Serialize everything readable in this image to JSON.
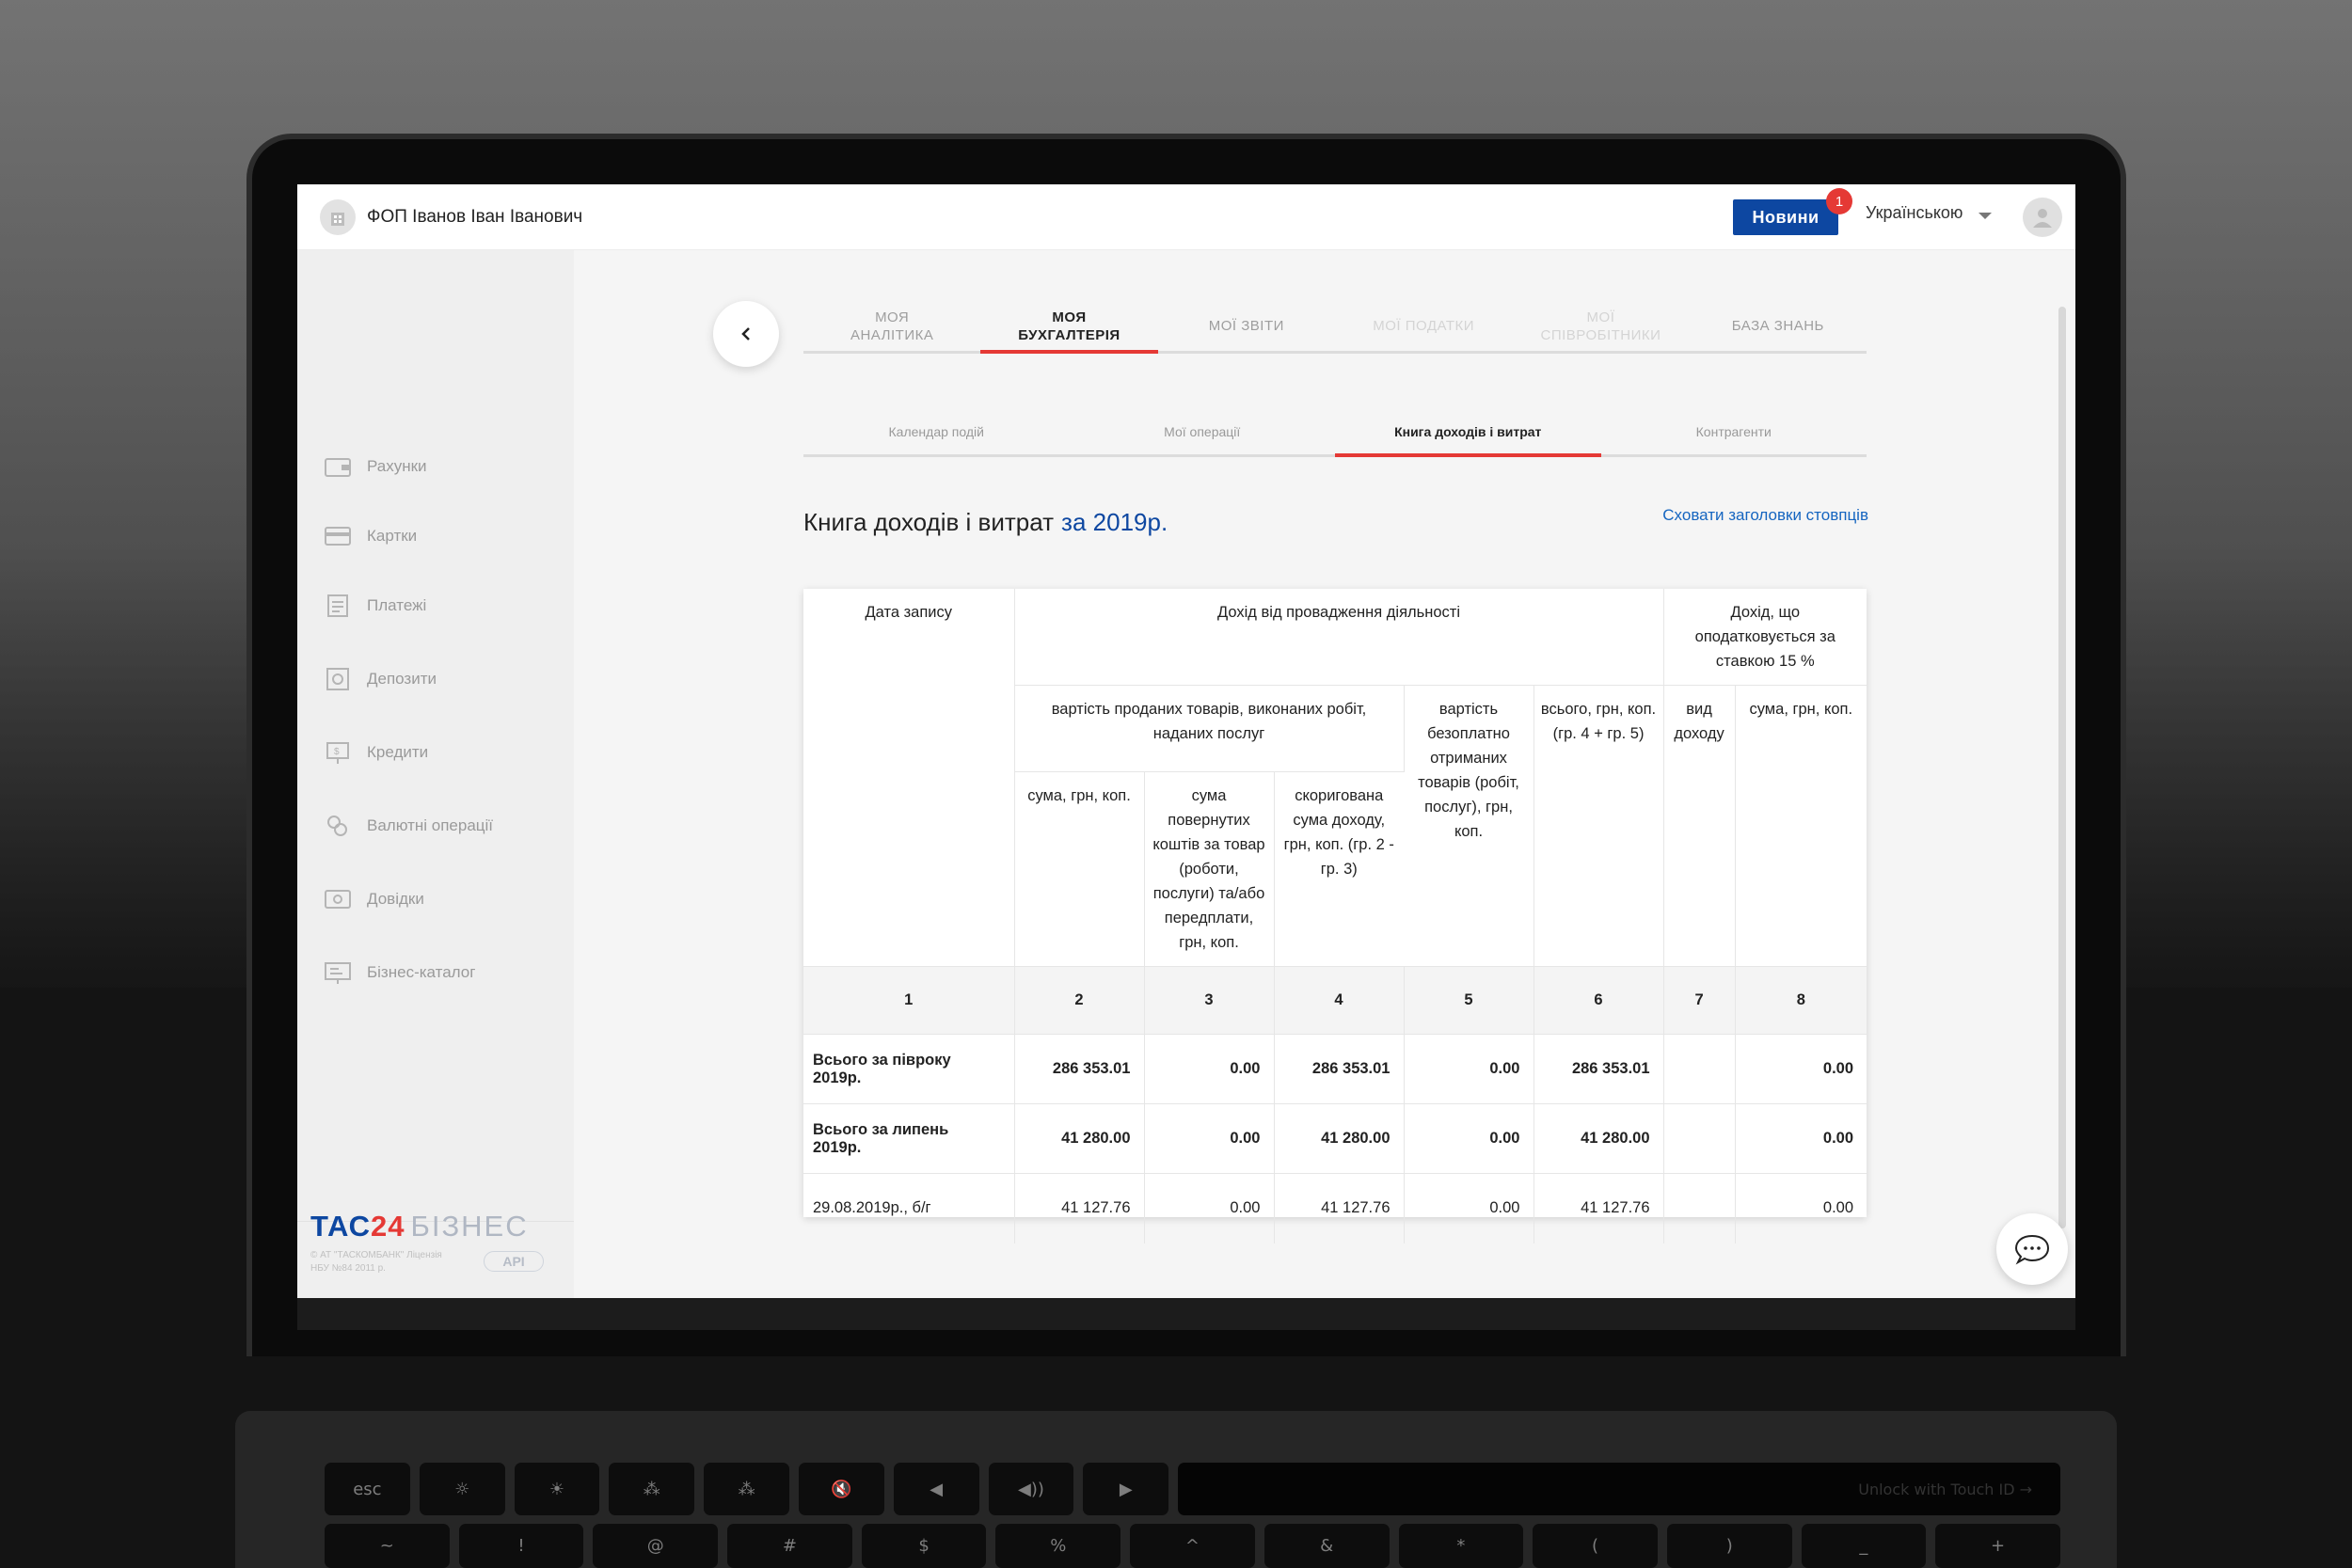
{
  "header": {
    "company_name": "ФОП Іванов Іван Іванович",
    "news_label": "Новини",
    "news_count": "1",
    "language": "Українською"
  },
  "sidebar": {
    "items": [
      {
        "label": "Рахунки",
        "icon": "wallet-icon"
      },
      {
        "label": "Картки",
        "icon": "card-icon"
      },
      {
        "label": "Платежі",
        "icon": "payments-icon"
      },
      {
        "label": "Депозити",
        "icon": "safe-icon"
      },
      {
        "label": "Кредити",
        "icon": "credit-icon"
      },
      {
        "label": "Валютні операції",
        "icon": "currency-icon"
      },
      {
        "label": "Довідки",
        "icon": "certificate-icon"
      },
      {
        "label": "Бізнес-каталог",
        "icon": "catalog-icon"
      }
    ],
    "brand": {
      "tas": "ТАС",
      "num": "24",
      "biz": "БІЗНЕС",
      "note": "© АТ \"ТАСКОМБАНК\" Ліцензія НБУ №84 2011 р.",
      "api": "API"
    }
  },
  "main_tabs": [
    {
      "label": "МОЯ АНАЛІТИКА",
      "state": "normal"
    },
    {
      "label": "МОЯ БУХГАЛТЕРІЯ",
      "state": "active"
    },
    {
      "label": "МОЇ ЗВІТИ",
      "state": "normal"
    },
    {
      "label": "МОЇ ПОДАТКИ",
      "state": "disabled"
    },
    {
      "label": "МОЇ СПІВРОБІТНИКИ",
      "state": "disabled"
    },
    {
      "label": "БАЗА ЗНАНЬ",
      "state": "normal"
    }
  ],
  "sub_tabs": [
    {
      "label": "Календар подій",
      "active": false
    },
    {
      "label": "Мої операції",
      "active": false
    },
    {
      "label": "Книга доходів і витрат",
      "active": true
    },
    {
      "label": "Контрагенти",
      "active": false
    }
  ],
  "page": {
    "title": "Книга доходів і витрат",
    "year": "за 2019р.",
    "hide_headers_link": "Сховати заголовки стовпців"
  },
  "table": {
    "h_date": "Дата запису",
    "h_income": "Дохід від провадження діяльності",
    "h_taxed15": "Дохід, що оподатковується за ставкою 15 %",
    "h_goods": "вартість проданих товарів, виконаних робіт, наданих послуг",
    "h_free": "вартість безоплатно отриманих товарів (робіт, послуг), грн, коп.",
    "h_total": "всього, грн, коп. (гр. 4 + гр. 5)",
    "h_kind": "вид доходу",
    "h_sum15": "сума, грн, коп.",
    "h_sum": "сума, грн, коп.",
    "h_returned": "сума повернутих коштів за товар (роботи, послуги) та/або передплати, грн, коп.",
    "h_adjusted": "скоригована сума доходу, грн, коп. (гр. 2 - гр. 3)",
    "column_numbers": [
      "1",
      "2",
      "3",
      "4",
      "5",
      "6",
      "7",
      "8"
    ],
    "rows": [
      {
        "date": "Всього за півроку 2019р.",
        "c2": "286 353.01",
        "c3": "0.00",
        "c4": "286 353.01",
        "c5": "0.00",
        "c6": "286 353.01",
        "c7": "",
        "c8": "0.00"
      },
      {
        "date": "Всього за липень 2019р.",
        "c2": "41 280.00",
        "c3": "0.00",
        "c4": "41 280.00",
        "c5": "0.00",
        "c6": "41 280.00",
        "c7": "",
        "c8": "0.00"
      },
      {
        "date": "29.08.2019р., б/г",
        "c2": "41 127.76",
        "c3": "0.00",
        "c4": "41 127.76",
        "c5": "0.00",
        "c6": "41 127.76",
        "c7": "",
        "c8": "0.00"
      }
    ]
  },
  "keyboard": {
    "esc": "esc",
    "touch_id_hint": "Unlock with Touch ID →",
    "number_keys": [
      "~",
      "!",
      "@",
      "#",
      "$",
      "%",
      "^",
      "&",
      "*",
      "(",
      ")",
      "_",
      "+"
    ]
  },
  "colors": {
    "accent_red": "#e53935",
    "brand_blue": "#0d47a1",
    "link_blue": "#1565c0"
  }
}
